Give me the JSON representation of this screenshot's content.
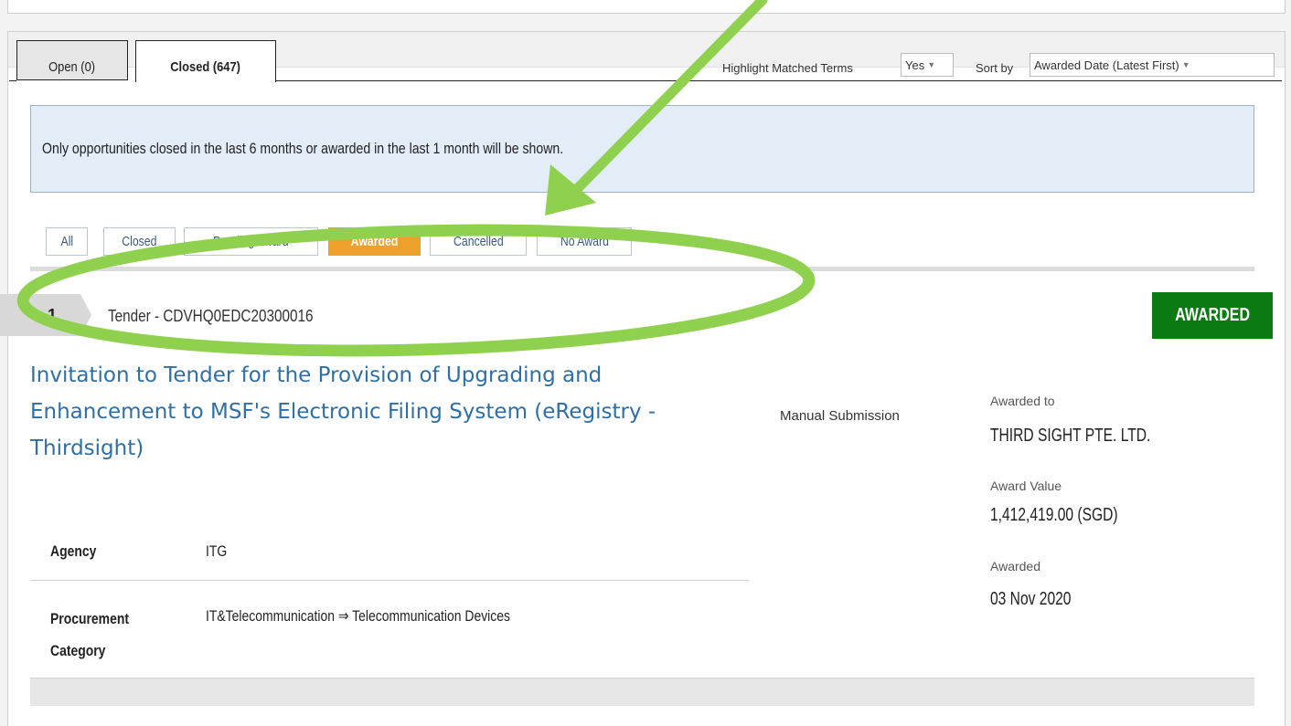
{
  "tabs": [
    {
      "label": "Open (0)",
      "active": false
    },
    {
      "label": "Closed (647)",
      "active": true
    }
  ],
  "controls": {
    "highlight_label": "Highlight Matched Terms",
    "highlight_value": "Yes",
    "sort_label": "Sort by",
    "sort_value": "Awarded Date (Latest First)"
  },
  "notice": "Only opportunities closed in the last 6 months or awarded in the last 1 month will be shown.",
  "filters": [
    {
      "label": "All",
      "active": false
    },
    {
      "label": "Closed",
      "active": false
    },
    {
      "label": "Pending Award",
      "active": false
    },
    {
      "label": "Awarded",
      "active": true
    },
    {
      "label": "Cancelled",
      "active": false
    },
    {
      "label": "No Award",
      "active": false
    }
  ],
  "result": {
    "index": "1",
    "reference": "Tender - CDVHQ0EDC20300016",
    "status": "AWARDED",
    "title": "Invitation to Tender for the Provision of Upgrading and Enhancement to MSF's Electronic Filing System (eRegistry - Thirdsight)",
    "agency_label": "Agency",
    "agency_value": "ITG",
    "category_label": "Procurement Category",
    "category_value": "IT&Telecommunication ⇒ Telecommunication Devices",
    "submission": "Manual Submission",
    "awarded_to_label": "Awarded to",
    "awarded_to_value": "THIRD SIGHT PTE. LTD.",
    "award_value_label": "Award Value",
    "award_value_value": "1,412,419.00 (SGD)",
    "awarded_label": "Awarded",
    "awarded_value": "03 Nov 2020"
  },
  "colors": {
    "annotation": "#8fd14f",
    "awarded_badge": "#0c7a13",
    "active_filter": "#eda02a",
    "link": "#2f6fa3"
  }
}
